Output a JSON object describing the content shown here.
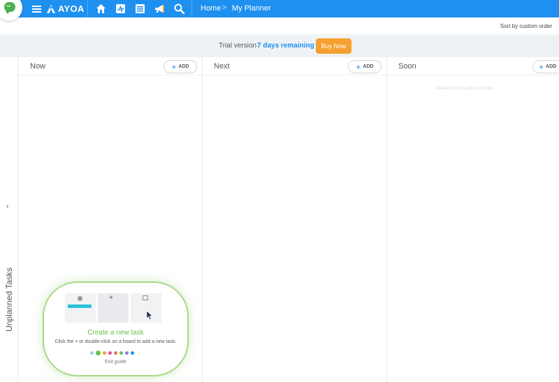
{
  "nav": {
    "logo_text": "AYOA",
    "breadcrumbs": [
      "Home",
      "My Planner"
    ],
    "breadcrumb_separator": ">",
    "icons": [
      "home-icon",
      "activity-icon",
      "boards-icon",
      "megaphone-icon",
      "search-icon"
    ]
  },
  "toolbar": {
    "sort_label": "Sort by custom order"
  },
  "trial": {
    "prefix": "Trial version",
    "days_text": "7 days remaining",
    "buy_label": "Buy Now"
  },
  "side": {
    "label": "Unplanned Tasks",
    "chevron": "›"
  },
  "columns": [
    {
      "title": "Now",
      "add_label": "ADD"
    },
    {
      "title": "Next",
      "add_label": "ADD"
    },
    {
      "title": "Soon",
      "add_label": "ADD",
      "hint": "Double-click to add a task here"
    }
  ],
  "guide": {
    "title": "Create a new task",
    "description": "Click the + or double-click on a board to add a new task.",
    "exit_label": "Exit guide",
    "step_dot_colors": [
      "#8fd3e8",
      "#6cc04a",
      "#f5a030",
      "#e84a8a",
      "#f07060",
      "#6cc04a",
      "#a070e0",
      "#1e90f0"
    ],
    "active_step": 1
  },
  "colors": {
    "accent": "#1e90f0",
    "buy": "#f5a030",
    "guide_green": "#6cc04a"
  }
}
